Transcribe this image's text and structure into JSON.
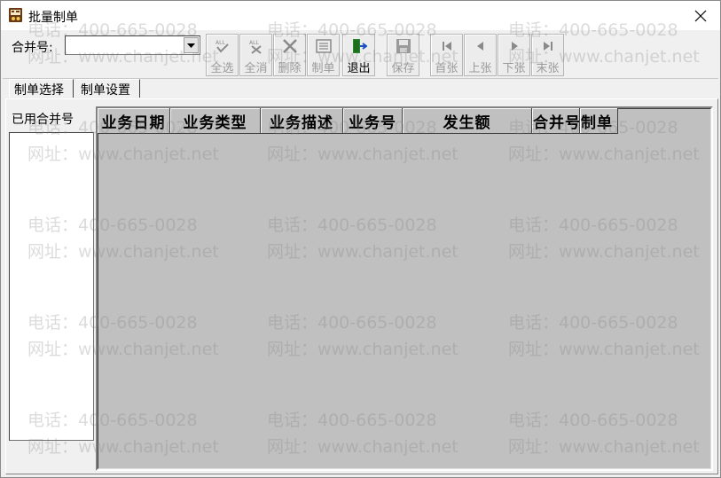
{
  "window": {
    "title": "批量制单",
    "close_glyph": "✕"
  },
  "toolbar": {
    "merge_label": "合并号:",
    "merge_value": "",
    "buttons": [
      {
        "key": "select-all",
        "label": "全选",
        "icon": "select-all-icon",
        "enabled": false
      },
      {
        "key": "deselect-all",
        "label": "全消",
        "icon": "deselect-all-icon",
        "enabled": false
      },
      {
        "key": "delete",
        "label": "删除",
        "icon": "delete-icon",
        "enabled": false
      },
      {
        "key": "make-voucher",
        "label": "制单",
        "icon": "voucher-icon",
        "enabled": false
      },
      {
        "key": "exit",
        "label": "退出",
        "icon": "exit-icon",
        "enabled": true
      },
      {
        "key": "save",
        "label": "保存",
        "icon": "save-icon",
        "enabled": false
      },
      {
        "key": "first",
        "label": "首张",
        "icon": "first-icon",
        "enabled": false
      },
      {
        "key": "prev",
        "label": "上张",
        "icon": "prev-icon",
        "enabled": false
      },
      {
        "key": "next",
        "label": "下张",
        "icon": "next-icon",
        "enabled": false
      },
      {
        "key": "last",
        "label": "末张",
        "icon": "last-icon",
        "enabled": false
      }
    ]
  },
  "tabs": [
    {
      "label": "制单选择",
      "active": true
    },
    {
      "label": "制单设置",
      "active": false
    }
  ],
  "left_panel": {
    "label": "已用合并号",
    "items": []
  },
  "grid": {
    "columns": [
      "业务日期",
      "业务类型",
      "业务描述",
      "业务号",
      "发生额",
      "合并号",
      "制单"
    ],
    "rows": []
  },
  "watermark": {
    "phone": "电话：400-665-0028",
    "site": "网址：www.chanjet.net"
  },
  "colors": {
    "grid_bg": "#c0c0c0",
    "window_bg": "#f0f0f0",
    "exit_icon_green": "#2a8a2a"
  }
}
